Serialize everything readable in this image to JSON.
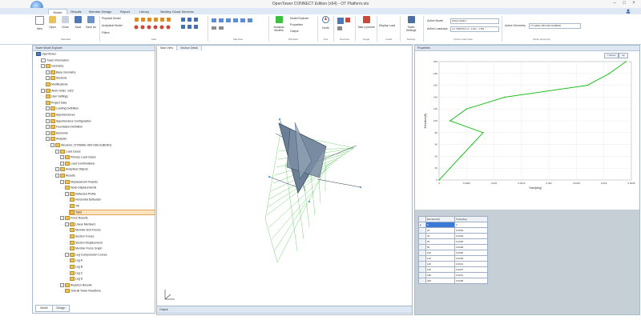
{
  "window": {
    "title": "OpenTower CONNECT Edition (x64) - OT Platform.otx",
    "controls": [
      "–",
      "□",
      "×"
    ]
  },
  "tabs": [
    "Model",
    "Results",
    "Member Design",
    "Report",
    "Library",
    "Bentley Cloud Services"
  ],
  "ribbon": {
    "file_buttons": [
      "New",
      "Open",
      "Close",
      "Save",
      "Save As"
    ],
    "file_group": "Standard",
    "view_toggles": [
      "Physical Model",
      "Analytical Model",
      "Filters"
    ],
    "view_group": "View",
    "selection_group": "Selection",
    "analysis_button": "Analysis Models",
    "windows_items": [
      "Model Explorer",
      "Properties",
      "Output"
    ],
    "windows_group": "Windows",
    "north_button": "North",
    "north_group": "Axis",
    "structure_group": "Structure",
    "take_picture": "Take a picture",
    "image_group": "Image",
    "display_load": "Display Load",
    "loads_group": "Loads",
    "tower_settings": "Tower Settings",
    "settings_group": "Settings",
    "active_model_label": "Active Model",
    "active_model_value": "Whole Model",
    "active_loadcase_label": "Active Loadcase",
    "active_loadcase_value": "LC: PERSTA LC: 1.2D + 1.6W...",
    "active_loadcase_group": "Active Load Case",
    "active_geometry_label": "Active Geometry",
    "active_geometry_value": "TYmdMe-OBY1S8-GLBENH",
    "active_geometry_group": "Active Geometry"
  },
  "explorer": {
    "title": "Tower Model Explorer",
    "tabs": [
      "Model",
      "Design"
    ],
    "nodes": [
      {
        "label": "OpenTower",
        "level": 0,
        "icon": "tower-icon",
        "plus": false
      },
      {
        "label": "Tower Information",
        "level": 1,
        "icon": "info-icon",
        "plus": false
      },
      {
        "label": "Geometry",
        "level": 1,
        "icon": "folder-icon",
        "plus": true
      },
      {
        "label": "Base Geometry",
        "level": 2,
        "icon": "folder-icon",
        "plus": true
      },
      {
        "label": "Sections",
        "level": 2,
        "icon": "folder-icon",
        "plus": true
      },
      {
        "label": "Modifications",
        "level": 2,
        "icon": "folder-icon",
        "plus": false
      },
      {
        "label": "Work Order: 1422",
        "level": 1,
        "icon": "folder-icon",
        "plus": true
      },
      {
        "label": "User Settings",
        "level": 2,
        "icon": "folder-icon",
        "plus": false
      },
      {
        "label": "Project Data",
        "level": 2,
        "icon": "folder-icon",
        "plus": false
      },
      {
        "label": "Loading Definition",
        "level": 2,
        "icon": "folder-icon",
        "plus": true
      },
      {
        "label": "Appurtenances",
        "level": 2,
        "icon": "folder-icon",
        "plus": true
      },
      {
        "label": "Appurtenance Configuration",
        "level": 2,
        "icon": "folder-icon",
        "plus": true
      },
      {
        "label": "Foundation Definition",
        "level": 2,
        "icon": "folder-icon",
        "plus": true
      },
      {
        "label": "Elements",
        "level": 2,
        "icon": "folder-icon",
        "plus": true
      },
      {
        "label": "Analysis",
        "level": 2,
        "icon": "folder-icon",
        "plus": true
      },
      {
        "label": "Structure: [TYMdMe-OBY1S8-GLBENH]",
        "level": 3,
        "icon": "folder-icon",
        "plus": true
      },
      {
        "label": "Load Cases",
        "level": 4,
        "icon": "folder-icon",
        "plus": true
      },
      {
        "label": "Primary Load Cases",
        "level": 5,
        "icon": "folder-icon",
        "plus": true
      },
      {
        "label": "Load Combinations",
        "level": 5,
        "icon": "folder-icon",
        "plus": true
      },
      {
        "label": "Analytical Objects",
        "level": 4,
        "icon": "folder-icon",
        "plus": true
      },
      {
        "label": "Results",
        "level": 4,
        "icon": "folder-icon",
        "plus": true
      },
      {
        "label": "Displacement Results",
        "level": 5,
        "icon": "folder-icon",
        "plus": true
      },
      {
        "label": "Node Displacements",
        "level": 6,
        "icon": "folder-icon",
        "plus": false
      },
      {
        "label": "Deflected Profile",
        "level": 6,
        "icon": "folder-icon",
        "plus": true
      },
      {
        "label": "Horizontal Deflection",
        "level": 7,
        "icon": "folder-icon",
        "plus": false
      },
      {
        "label": "Tilt",
        "level": 7,
        "icon": "folder-icon",
        "plus": false
      },
      {
        "label": "Twist",
        "level": 7,
        "icon": "folder-icon",
        "plus": false,
        "selected": true
      },
      {
        "label": "Force Results",
        "level": 5,
        "icon": "folder-icon",
        "plus": true
      },
      {
        "label": "Linear Members",
        "level": 6,
        "icon": "folder-icon",
        "plus": true
      },
      {
        "label": "Member End Forces",
        "level": 7,
        "icon": "folder-icon",
        "plus": false
      },
      {
        "label": "Section Forces",
        "level": 7,
        "icon": "folder-icon",
        "plus": false
      },
      {
        "label": "Section Displacement",
        "level": 7,
        "icon": "folder-icon",
        "plus": false
      },
      {
        "label": "Member Force Graph",
        "level": 7,
        "icon": "folder-icon",
        "plus": false
      },
      {
        "label": "Leg Compression Curves",
        "level": 6,
        "icon": "folder-icon",
        "plus": true
      },
      {
        "label": "Leg A",
        "level": 7,
        "icon": "folder-icon",
        "plus": false
      },
      {
        "label": "Leg B",
        "level": 7,
        "icon": "folder-icon",
        "plus": false
      },
      {
        "label": "Leg C",
        "level": 7,
        "icon": "folder-icon",
        "plus": false
      },
      {
        "label": "Leg D",
        "level": 7,
        "icon": "folder-icon",
        "plus": false
      },
      {
        "label": "Reaction Results",
        "level": 5,
        "icon": "folder-icon",
        "plus": true
      },
      {
        "label": "Overall Tower Reactions",
        "level": 6,
        "icon": "folder-icon",
        "plus": false
      }
    ]
  },
  "main_view": {
    "tabs": [
      "Main View",
      "Section Detail"
    ],
    "output_label": "Output"
  },
  "properties": {
    "title": "Properties",
    "chart_buttons": [
      "Y Zoom",
      "ok"
    ],
    "table_headers": [
      "Elevation(ft)",
      "Twist(deg)"
    ],
    "table_rows": [
      [
        "0",
        "0"
      ],
      [
        "20",
        "0.0002"
      ],
      [
        "40",
        "0.0004"
      ],
      [
        "60",
        "0.0006"
      ],
      [
        "80",
        "0.0008"
      ],
      [
        "100",
        "0.0002"
      ],
      [
        "120",
        "0.0005"
      ],
      [
        "140",
        "0.0012"
      ],
      [
        "160",
        "0.0027"
      ],
      [
        "180",
        "0.0021"
      ],
      [
        "200",
        "0.0028"
      ]
    ]
  },
  "chart_data": {
    "type": "line",
    "title": "",
    "xlabel": "Twist(deg)",
    "ylabel": "Elevation(ft)",
    "xlim": [
      0,
      0.0035
    ],
    "ylim": [
      0,
      200
    ],
    "xticks": [
      "0",
      "0.0005",
      "0.001",
      "0.0015",
      "0.002",
      "0.0025",
      "0.003",
      "0.0035"
    ],
    "yticks": [
      "0",
      "20",
      "40",
      "60",
      "80",
      "100",
      "120",
      "140",
      "160",
      "180",
      "200"
    ],
    "grid": true,
    "series": [
      {
        "name": "",
        "color": "#22c022",
        "x": [
          0,
          0.0002,
          0.0004,
          0.0006,
          0.0008,
          0.0002,
          0.0005,
          0.0012,
          0.0027,
          0.0031,
          0.0034
        ],
        "y": [
          0,
          20,
          40,
          60,
          80,
          100,
          120,
          140,
          160,
          180,
          200
        ]
      }
    ]
  },
  "colors": {
    "accent": "#2d74c9",
    "ribbon_tab_bg": "#dfe9f5",
    "model_green": "#3fbf3f",
    "plate_gray": "#6a7f95",
    "selection": "#fbe3c0"
  }
}
